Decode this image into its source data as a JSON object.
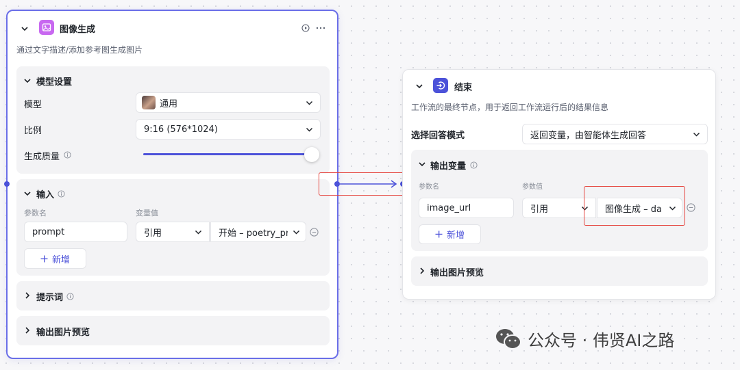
{
  "left_node": {
    "title": "图像生成",
    "description": "通过文字描述/添加参考图生成图片",
    "model_section": {
      "title": "模型设置",
      "model_label": "模型",
      "model_value": "通用",
      "ratio_label": "比例",
      "ratio_value": "9:16 (576*1024)",
      "quality_label": "生成质量",
      "quality_level": 1.0
    },
    "input_section": {
      "title": "输入",
      "param_name_header": "参数名",
      "var_value_header": "变量值",
      "row": {
        "name": "prompt",
        "ref_type": "引用",
        "ref_value": "开始 – poetry_pr"
      },
      "add_label": "新增"
    },
    "prompt_section": {
      "title": "提示词"
    },
    "preview_section": {
      "title": "输出图片预览"
    }
  },
  "right_node": {
    "title": "结束",
    "description": "工作流的最终节点，用于返回工作流运行后的结果信息",
    "mode_label": "选择回答模式",
    "mode_value": "返回变量，由智能体生成回答",
    "output_section": {
      "title": "输出变量",
      "param_name_header": "参数名",
      "param_value_header": "参数值",
      "row": {
        "name": "image_url",
        "ref_type": "引用",
        "ref_value": "图像生成 – da"
      },
      "add_label": "新增"
    },
    "preview_section": {
      "title": "输出图片预览"
    }
  },
  "watermark": {
    "text": "公众号 · 伟贤AI之路"
  },
  "colors": {
    "accent": "#4c52d9",
    "selected_border": "#6a6ee8",
    "highlight_red": "#e5423c"
  }
}
